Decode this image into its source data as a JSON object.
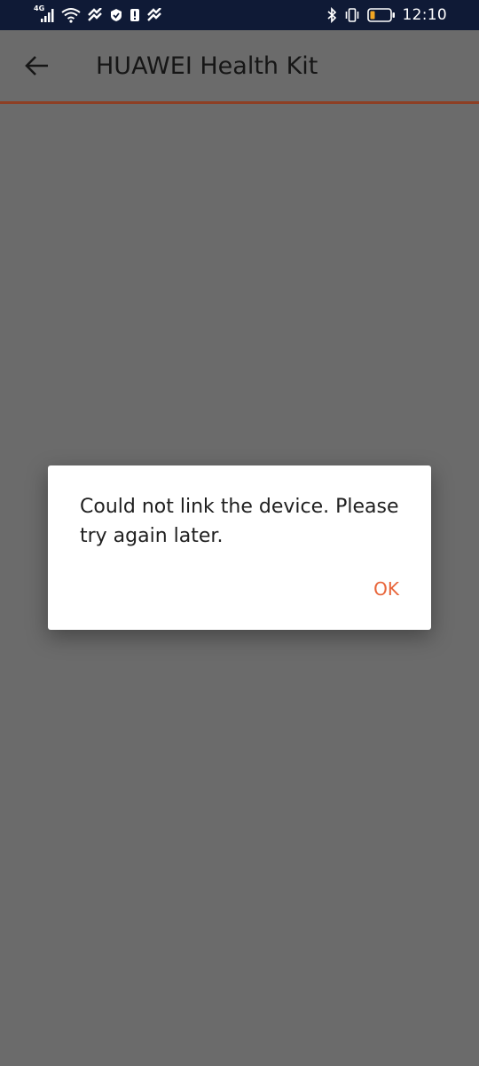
{
  "status_bar": {
    "network_type": "4G",
    "time": "12:10",
    "icons": [
      "signal-icon",
      "wifi-icon",
      "app-notification-icon",
      "shield-icon",
      "alert-icon",
      "app-notification-icon",
      "bluetooth-icon",
      "vibrate-icon",
      "battery-icon"
    ]
  },
  "app_bar": {
    "title": "HUAWEI Health Kit",
    "accent_color": "#8d3f24"
  },
  "dialog": {
    "message": "Could not link the device. Please try again later.",
    "ok_label": "OK",
    "ok_color": "#e8653a"
  }
}
